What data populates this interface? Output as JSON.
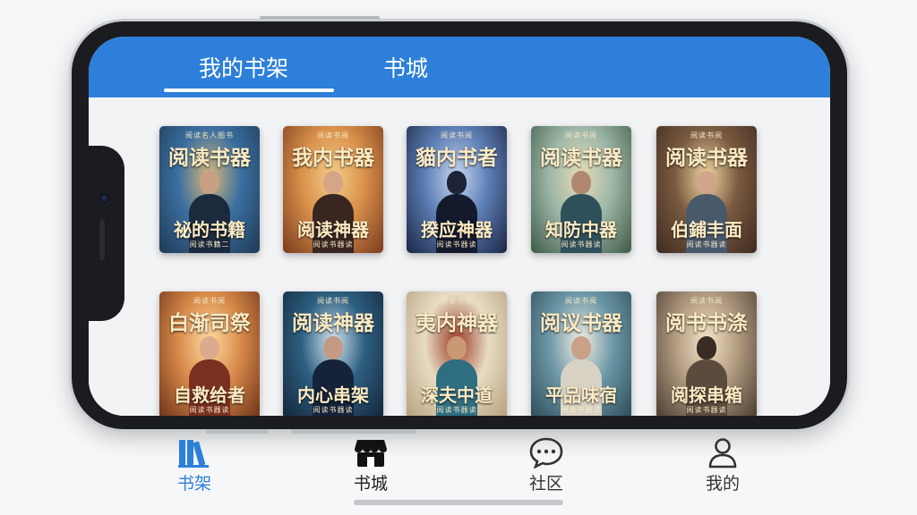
{
  "top_tabs": {
    "shelf": "我的书架",
    "store": "书城",
    "active": "shelf"
  },
  "books": [
    {
      "top": "阅读名人图书",
      "title1": "阅读书器",
      "title2": "祕的书籍",
      "bottom": "阅读书籍二",
      "colors": {
        "sky": "#3b6fa0",
        "ground": "#1f3a55",
        "accent": "#d7b97a",
        "figure": "#1b2a3c",
        "skin": "#c99f86"
      }
    },
    {
      "top": "阅读书阅",
      "title1": "我内书器",
      "title2": "阅读神器",
      "bottom": "阅读书器读",
      "colors": {
        "sky": "#d9904a",
        "ground": "#7a3b1e",
        "accent": "#f4cf8a",
        "figure": "#3a2620",
        "skin": "#d6a486"
      }
    },
    {
      "top": "阅读书阅",
      "title1": "貓内书者",
      "title2": "揆应神器",
      "bottom": "阅读书器读",
      "colors": {
        "sky": "#5d7fb5",
        "ground": "#1b2544",
        "accent": "#c8d6f0",
        "figure": "#141a2c",
        "skin": "#1d2438"
      }
    },
    {
      "top": "阅读书阅",
      "title1": "阅读书器",
      "title2": "知防中器",
      "bottom": "阅读书器读",
      "colors": {
        "sky": "#9db7a8",
        "ground": "#3e5a46",
        "accent": "#e8ddb8",
        "figure": "#2f4f5a",
        "skin": "#b08870"
      }
    },
    {
      "top": "阅读书阅",
      "title1": "阅读书器",
      "title2": "伯鋪丰面",
      "bottom": "阅读书器读",
      "colors": {
        "sky": "#7a5a40",
        "ground": "#3d2a20",
        "accent": "#f0d6a0",
        "figure": "#48596b",
        "skin": "#d2a58a"
      }
    },
    {
      "top": "阅读书阅",
      "title1": "白渐司祭",
      "title2": "自救给者",
      "bottom": "阅读书器读",
      "colors": {
        "sky": "#d88a4a",
        "ground": "#6d3218",
        "accent": "#ffdba0",
        "figure": "#7a3020",
        "skin": "#dcaa8c"
      }
    },
    {
      "top": "阅读书阅",
      "title1": "阅读神器",
      "title2": "内心串架",
      "bottom": "阅读书器读",
      "colors": {
        "sky": "#2d5f80",
        "ground": "#13253a",
        "accent": "#d2e4f0",
        "figure": "#14223a",
        "skin": "#c49a84"
      }
    },
    {
      "top": "阅读书阅",
      "title1": "夷内神器",
      "title2": "深夫中道",
      "bottom": "阅读书器读",
      "colors": {
        "sky": "#e7dcc4",
        "ground": "#b7a07c",
        "accent": "#9c3a24",
        "figure": "#2f6d80",
        "skin": "#c99874"
      }
    },
    {
      "top": "阅读书阅",
      "title1": "阅议书器",
      "title2": "平品味宿",
      "bottom": "阅读书器读",
      "colors": {
        "sky": "#6d98a8",
        "ground": "#2c4c58",
        "accent": "#f2efe0",
        "figure": "#d8d2c4",
        "skin": "#caa088"
      }
    },
    {
      "top": "阅读书阅",
      "title1": "阅书书涤",
      "title2": "阅探串箱",
      "bottom": "阅读书器读",
      "colors": {
        "sky": "#b09a80",
        "ground": "#4a3c30",
        "accent": "#f5e6c8",
        "figure": "#5c4a3c",
        "skin": "#3a2c24"
      }
    }
  ],
  "bottom_nav": {
    "items": [
      {
        "label": "书架",
        "icon": "bookshelf-icon",
        "active": true
      },
      {
        "label": "书城",
        "icon": "store-icon",
        "active": false
      },
      {
        "label": "社区",
        "icon": "chat-bubble-icon",
        "active": false
      },
      {
        "label": "我的",
        "icon": "person-icon",
        "active": false
      }
    ],
    "active_color": "#2d7fd9",
    "inactive_color": "#333333"
  }
}
